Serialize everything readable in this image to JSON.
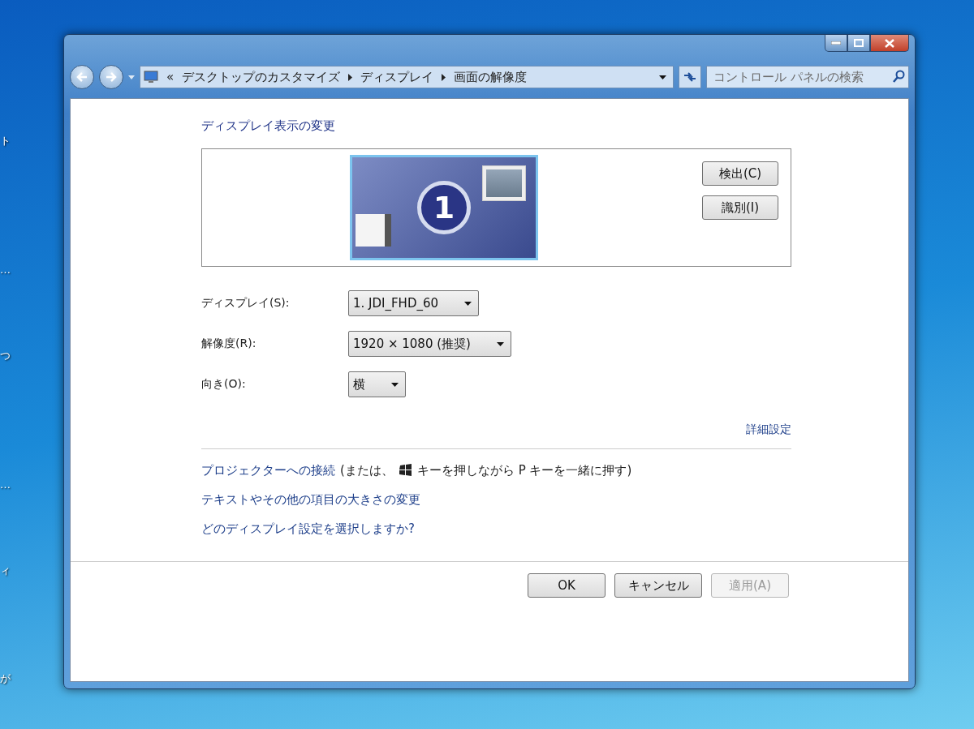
{
  "desktop": {
    "icon_labels": [
      "ト",
      "…",
      "つ",
      "…",
      "ィ",
      "が"
    ]
  },
  "address_bar": {
    "prefix": "«",
    "breadcrumbs": [
      "デスクトップのカスタマイズ",
      "ディスプレイ",
      "画面の解像度"
    ]
  },
  "search": {
    "placeholder": "コントロール パネルの検索"
  },
  "heading": "ディスプレイ表示の変更",
  "monitor_preview": {
    "number": "1"
  },
  "side_buttons": [
    "検出(C)",
    "識別(I)"
  ],
  "settings": [
    {
      "label": "ディスプレイ(S):",
      "value": "1. JDI_FHD_60"
    },
    {
      "label": "解像度(R):",
      "value": "1920 × 1080 (推奨)"
    },
    {
      "label": "向き(O):",
      "value": "横"
    }
  ],
  "advanced_link": "詳細設定",
  "projector": {
    "link": "プロジェクターへの接続",
    "before_icon": "(または、",
    "after_icon": "キーを押しながら P キーを一緒に押す)"
  },
  "links": [
    "テキストやその他の項目の大きさの変更",
    "どのディスプレイ設定を選択しますか?"
  ],
  "buttons": [
    {
      "label": "OK",
      "disabled": false
    },
    {
      "label": "キャンセル",
      "disabled": false
    },
    {
      "label": "適用(A)",
      "disabled": true
    }
  ]
}
